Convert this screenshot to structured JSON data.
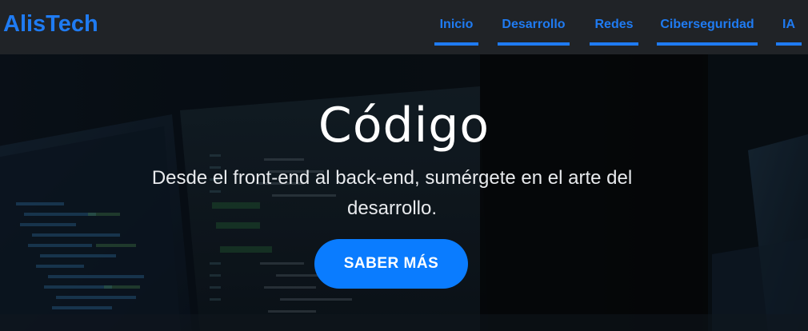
{
  "brand": {
    "name": "AlisTech"
  },
  "nav": {
    "items": [
      {
        "label": "Inicio"
      },
      {
        "label": "Desarrollo"
      },
      {
        "label": "Redes"
      },
      {
        "label": "Ciberseguridad"
      },
      {
        "label": "IA"
      }
    ]
  },
  "hero": {
    "title": "Código",
    "subtitle": "Desde el front-end al back-end, sumérgete en el arte del desarrollo.",
    "cta_label": "SABER MÁS",
    "background_icon": "code-on-laptop-screens"
  },
  "colors": {
    "accent": "#1f7bf2",
    "button": "#0a7cff",
    "navbar": "#202327"
  }
}
